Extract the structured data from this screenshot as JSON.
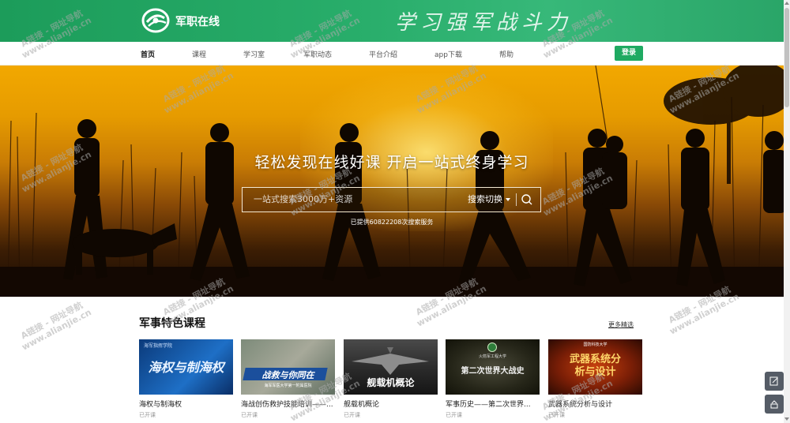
{
  "header": {
    "brand": "军职在线",
    "slogan": "学习强军战斗力"
  },
  "nav": {
    "items": [
      "首页",
      "课程",
      "学习室",
      "军职动态",
      "平台介绍",
      "app下载",
      "帮助"
    ],
    "login_label": "登录"
  },
  "hero": {
    "title": "轻松发现在线好课 开启一站式终身学习",
    "search_placeholder": "一站式搜索3000万+资源",
    "search_switch_label": "搜索切换",
    "stat_text": "已提供60822208次搜索服务"
  },
  "section": {
    "title": "军事特色课程",
    "more_label": "更多精选",
    "courses": [
      {
        "title": "海权与制海权",
        "status": "已开课",
        "thumb_text": "海权与制海权",
        "thumb_caption": "海军指挥学院"
      },
      {
        "title": "海战创伤救护技能培训——...",
        "status": "已开课",
        "thumb_text": "战救与你同在",
        "thumb_caption": "海军军医大学第一附属医院"
      },
      {
        "title": "舰载机概论",
        "status": "已开课",
        "thumb_text": "舰载机概论",
        "thumb_caption": ""
      },
      {
        "title": "军事历史——第二次世界...",
        "status": "已开课",
        "thumb_text": "第二次世界大战史",
        "thumb_caption": "火箭军工程大学"
      },
      {
        "title": "武器系统分析与设计",
        "status": "已开课",
        "thumb_text": "武器系统分析与设计",
        "thumb_caption": "国防科技大学"
      }
    ]
  },
  "watermark": {
    "line1": "A链接 - 网址导航",
    "line2": "www.alianjie.cn"
  },
  "colors": {
    "brand_green": "#1faa62",
    "hero_orange": "#e69b00"
  },
  "icons": {
    "search": "magnifier-icon",
    "feedback": "edit-icon",
    "top": "upload-icon"
  }
}
